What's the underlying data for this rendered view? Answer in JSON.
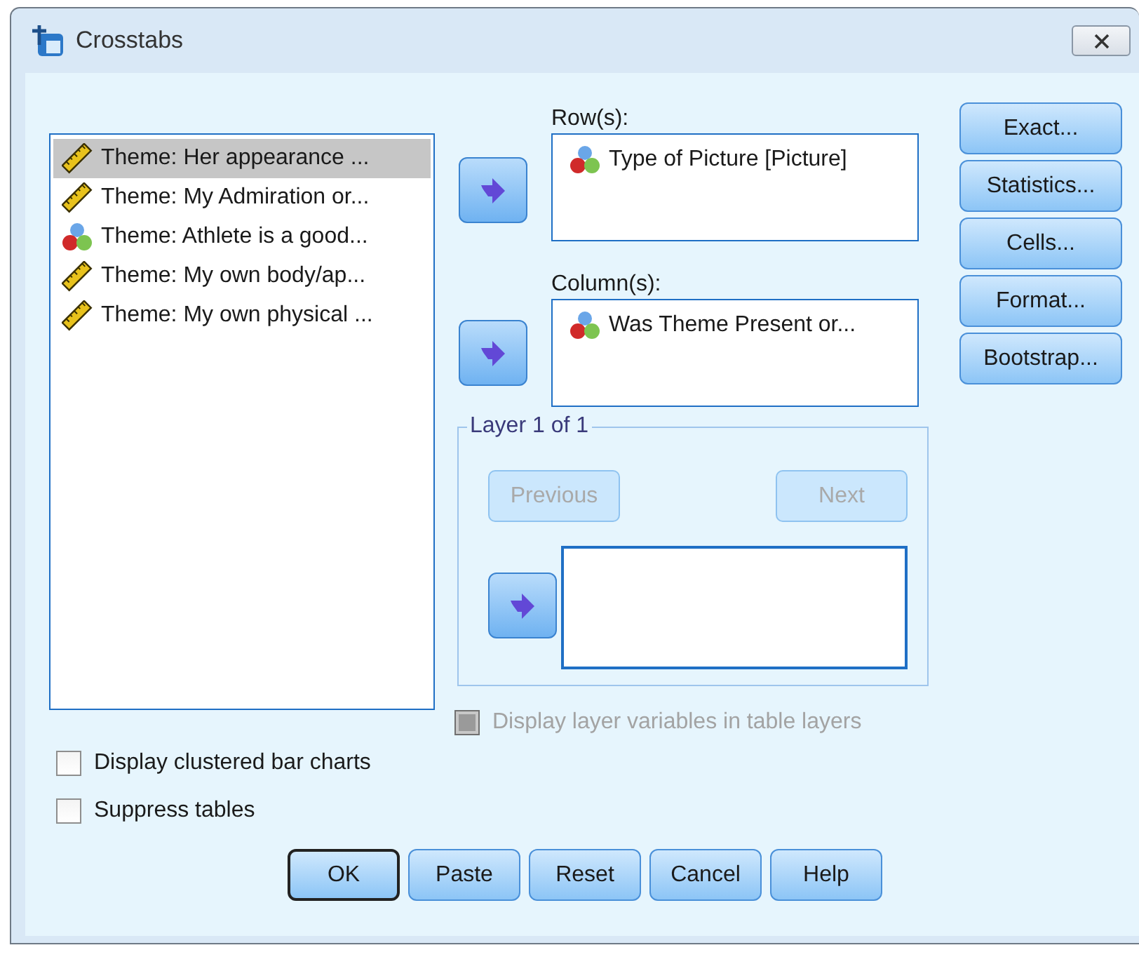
{
  "window": {
    "title": "Crosstabs"
  },
  "variables": [
    {
      "label": "Theme: Her appearance ...",
      "kind": "scale",
      "selected": true
    },
    {
      "label": "Theme: My Admiration or...",
      "kind": "scale",
      "selected": false
    },
    {
      "label": "Theme: Athlete is a good...",
      "kind": "nominal",
      "selected": false
    },
    {
      "label": "Theme: My own body/ap...",
      "kind": "scale",
      "selected": false
    },
    {
      "label": "Theme: My own physical ...",
      "kind": "scale",
      "selected": false
    }
  ],
  "rows": {
    "label": "Row(s):",
    "items": [
      {
        "label": "Type of Picture [Picture]",
        "kind": "nominal"
      }
    ]
  },
  "columns": {
    "label": "Column(s):",
    "items": [
      {
        "label": "Was Theme Present or...",
        "kind": "nominal"
      }
    ]
  },
  "layer": {
    "title": "Layer 1 of 1",
    "previous": {
      "label": "Previous",
      "disabled": true
    },
    "next": {
      "label": "Next",
      "disabled": true
    }
  },
  "display_layer_variables": {
    "label": "Display layer variables in table layers",
    "checked": false,
    "disabled": true
  },
  "options": [
    {
      "label": "Display clustered bar charts",
      "checked": false
    },
    {
      "label": "Suppress tables",
      "checked": false
    }
  ],
  "side_buttons": [
    {
      "label": "Exact..."
    },
    {
      "label": "Statistics..."
    },
    {
      "label": "Cells..."
    },
    {
      "label": "Format..."
    },
    {
      "label": "Bootstrap..."
    }
  ],
  "buttons": [
    {
      "label": "OK",
      "default": true
    },
    {
      "label": "Paste",
      "default": false
    },
    {
      "label": "Reset",
      "default": false
    },
    {
      "label": "Cancel",
      "default": false
    },
    {
      "label": "Help",
      "default": false
    }
  ]
}
